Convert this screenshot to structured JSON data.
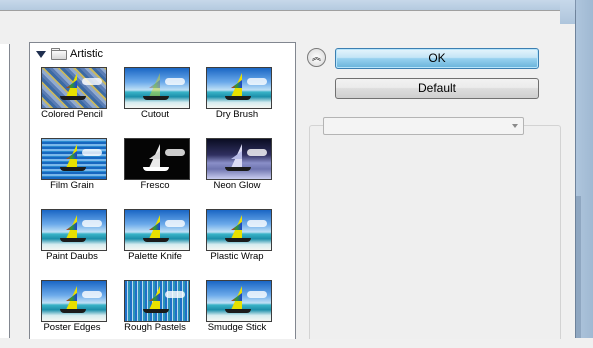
{
  "gallery": {
    "category": "Artistic",
    "filters": [
      {
        "label": "Colored Pencil",
        "style": "v-colored"
      },
      {
        "label": "Cutout",
        "style": "v-cutout"
      },
      {
        "label": "Dry Brush",
        "style": "v-plain"
      },
      {
        "label": "Film Grain",
        "style": "v-film"
      },
      {
        "label": "Fresco",
        "style": "v-fresco"
      },
      {
        "label": "Neon Glow",
        "style": "v-neon"
      },
      {
        "label": "Paint Daubs",
        "style": "v-plain"
      },
      {
        "label": "Palette Knife",
        "style": "v-plain"
      },
      {
        "label": "Plastic Wrap",
        "style": "v-plain"
      },
      {
        "label": "Poster Edges",
        "style": "v-plain"
      },
      {
        "label": "Rough Pastels",
        "style": "v-rough"
      },
      {
        "label": "Smudge Stick",
        "style": "v-plain"
      }
    ]
  },
  "buttons": {
    "ok_label": "OK",
    "default_label": "Default"
  },
  "settings": {
    "filter_select_value": ""
  },
  "colors": {
    "ok_accent": "#3c7fb1",
    "window_frame": "#aec5dc"
  }
}
